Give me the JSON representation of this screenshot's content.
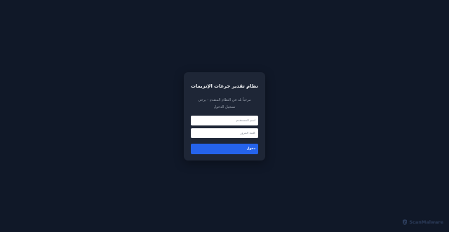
{
  "login": {
    "title": "نظام تقدير جرعات الإنزيمات",
    "subtitle": "مرحباً بك في النظام المتقدم - يرجى تسجيل الدخول",
    "username_placeholder": "اسم المستخدم",
    "password_placeholder": "كلمة المرور",
    "submit_label": "دخول"
  },
  "watermark": {
    "text": "ScanMalware",
    "icon": "scanmalware-logo-icon"
  },
  "colors": {
    "background": "#101828",
    "card": "#1e2636",
    "accent": "#2563eb"
  }
}
